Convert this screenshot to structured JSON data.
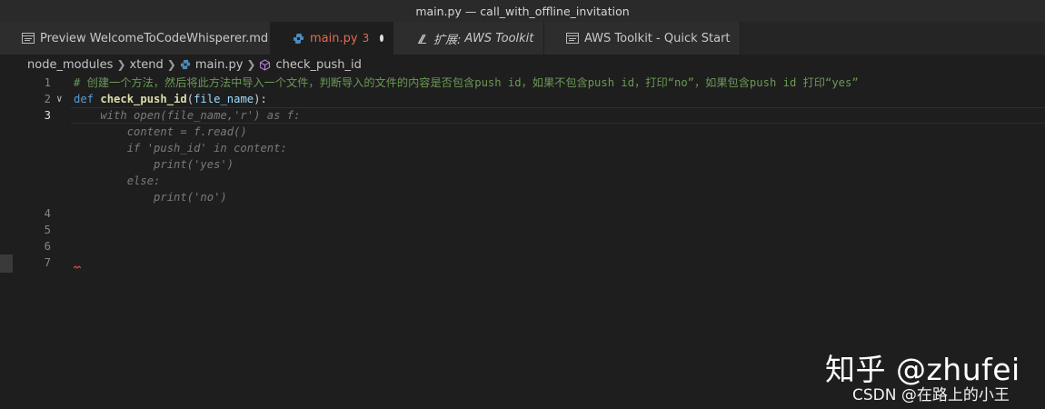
{
  "window": {
    "title": "main.py — call_with_offline_invitation"
  },
  "tabs": [
    {
      "label": "Preview WelcomeToCodeWhisperer.md",
      "icon": "preview-icon"
    },
    {
      "label": "main.py",
      "dirty_count": "3",
      "icon": "python-icon",
      "active": true,
      "unsaved": true
    },
    {
      "prefix": "扩展:",
      "label": "AWS Toolkit",
      "icon": "extension-icon"
    },
    {
      "label": "AWS Toolkit - Quick Start",
      "icon": "preview-icon"
    }
  ],
  "breadcrumb": {
    "items": [
      "node_modules",
      "xtend",
      "main.py",
      "check_push_id"
    ]
  },
  "editor": {
    "line_numbers": [
      "1",
      "2",
      "3",
      "4",
      "5",
      "6",
      "7"
    ],
    "line1_comment": "# 创建一个方法，然后将此方法中导入一个文件，判断导入的文件的内容是否包含push id，如果不包含push id，打印“no”，如果包含push id 打印“yes”",
    "line2": {
      "kw": "def",
      "fn": "check_push_id",
      "open": "(",
      "param": "file_name",
      "close": "):"
    },
    "suggestion": [
      "    with open(file_name,'r') as f:",
      "        content = f.read()",
      "        if 'push_id' in content:",
      "            print('yes')",
      "        else:",
      "            print('no')"
    ]
  },
  "colors": {
    "accent_tab": "#e06c4f",
    "background": "#1e1e1e",
    "keyword": "#569cd6",
    "function": "#dcdcaa",
    "comment": "#6a9955"
  },
  "watermark": {
    "main": "知乎 @zhufei",
    "sub": "CSDN @在路上的小王"
  }
}
